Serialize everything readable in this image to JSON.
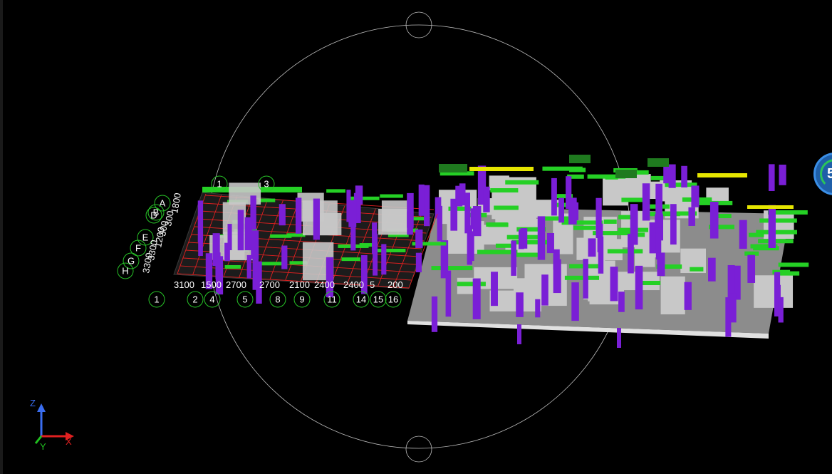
{
  "viewport": {
    "background": "#000000",
    "view_mode": "3d-isometric"
  },
  "grid": {
    "column_labels": [
      "1",
      "2",
      "4",
      "5",
      "8",
      "9",
      "11",
      "14",
      "15",
      "16"
    ],
    "top_labels": [
      "1",
      "3"
    ],
    "row_labels": [
      "A",
      "B",
      "D",
      "E",
      "F",
      "G",
      "H"
    ],
    "spacing_labels": [
      "3100",
      "1500",
      "2700",
      "2700",
      "2100",
      "2400",
      "2400",
      "5",
      "200"
    ],
    "row_spacing_labels": [
      "1800",
      "300",
      "300",
      "1200",
      "3300",
      "3300"
    ]
  },
  "axis_triad": {
    "z_label": "Z",
    "y_label": "Y",
    "x_label": "X",
    "z_color": "#3a6df0",
    "y_color": "#20c020",
    "x_color": "#e02020"
  },
  "colors": {
    "column": "#7a1fd6",
    "beam": "#25d025",
    "slab": "#c8c8c8",
    "grid_line": "#e02020",
    "axis_bubble": "#27c227",
    "highlight": "#e6e600"
  },
  "status_badge": {
    "value": "5"
  }
}
